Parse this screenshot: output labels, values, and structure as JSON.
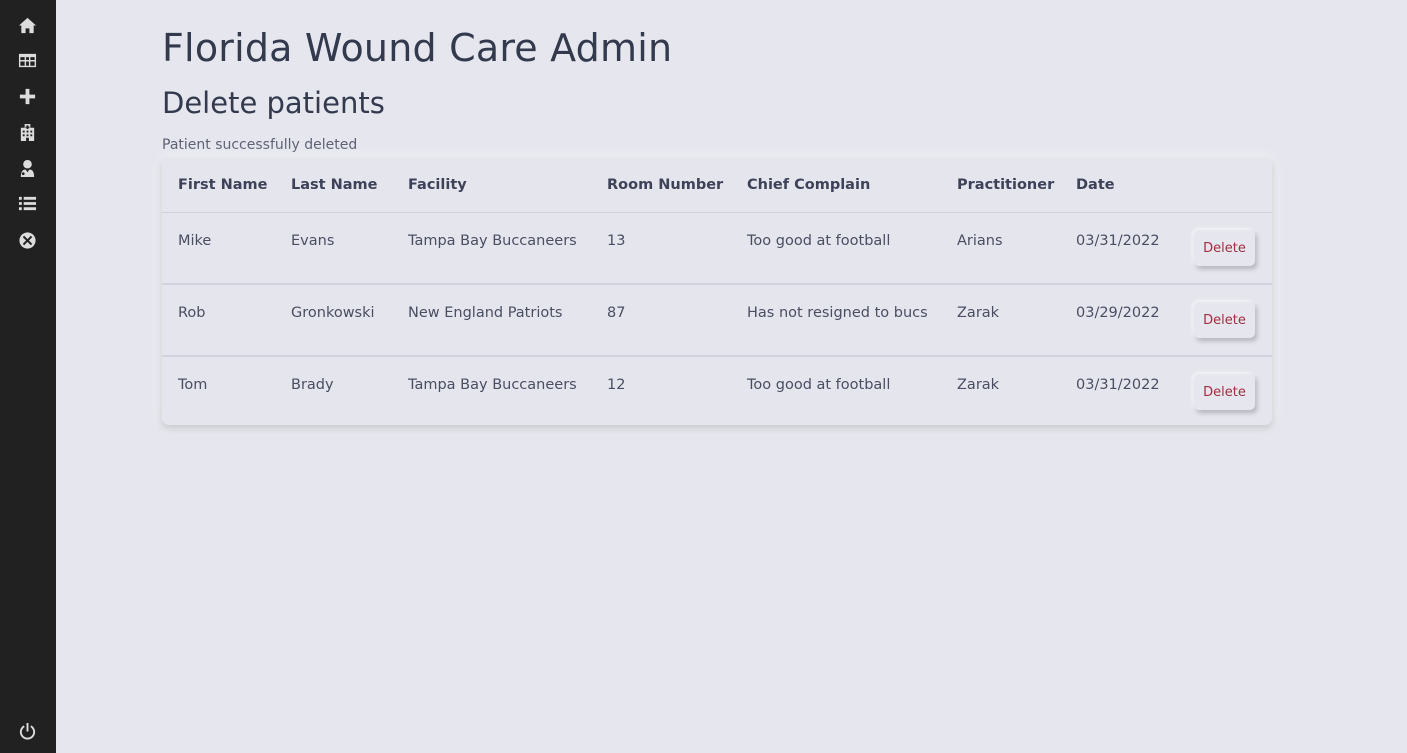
{
  "sidebar": {
    "items": [
      {
        "icon": "home-icon"
      },
      {
        "icon": "table-icon"
      },
      {
        "icon": "plus-icon"
      },
      {
        "icon": "hospital-icon"
      },
      {
        "icon": "doctor-icon"
      },
      {
        "icon": "list-icon"
      },
      {
        "icon": "close-circle-icon"
      }
    ],
    "footer_icon": "power-icon"
  },
  "header": {
    "app_title": "Florida Wound Care Admin",
    "page_title": "Delete patients",
    "status_message": "Patient successfully deleted"
  },
  "table": {
    "columns": [
      "First Name",
      "Last Name",
      "Facility",
      "Room Number",
      "Chief Complain",
      "Practitioner",
      "Date",
      ""
    ],
    "rows": [
      {
        "first_name": "Mike",
        "last_name": "Evans",
        "facility": "Tampa Bay Buccaneers",
        "room": "13",
        "complaint": "Too good at football",
        "practitioner": "Arians",
        "date": "03/31/2022",
        "action": "Delete"
      },
      {
        "first_name": "Rob",
        "last_name": "Gronkowski",
        "facility": "New England Patriots",
        "room": "87",
        "complaint": "Has not resigned to bucs",
        "practitioner": "Zarak",
        "date": "03/29/2022",
        "action": "Delete"
      },
      {
        "first_name": "Tom",
        "last_name": "Brady",
        "facility": "Tampa Bay Buccaneers",
        "room": "12",
        "complaint": "Too good at football",
        "practitioner": "Zarak",
        "date": "03/31/2022",
        "action": "Delete"
      }
    ]
  },
  "colors": {
    "sidebar_bg": "#212121",
    "page_bg": "#e5e6ee",
    "delete_text": "#a12c3f"
  }
}
